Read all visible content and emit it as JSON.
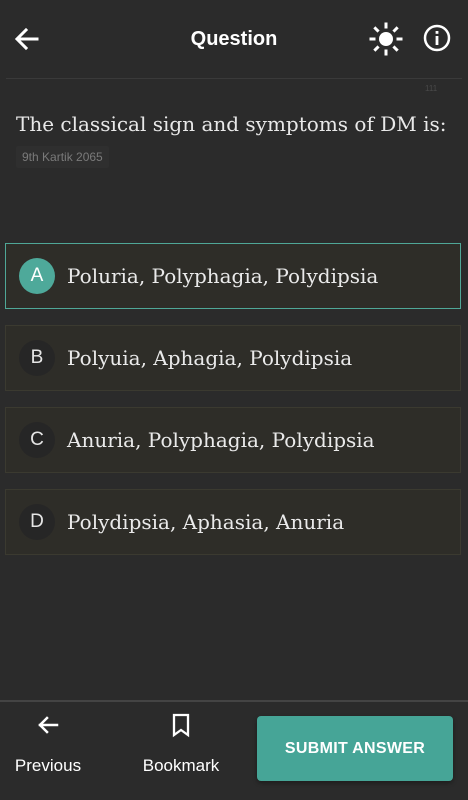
{
  "header": {
    "title": "Question",
    "back_icon": "arrow-left-icon",
    "theme_icon": "sun-icon",
    "info_icon": "info-icon"
  },
  "question": {
    "text": "The classical sign and symptoms of DM is:",
    "tag": "9th Kartik 2065"
  },
  "options": [
    {
      "letter": "A",
      "text": "Poluria, Polyphagia, Polydipsia",
      "selected": true
    },
    {
      "letter": "B",
      "text": "Polyuia, Aphagia, Polydipsia",
      "selected": false
    },
    {
      "letter": "C",
      "text": "Anuria, Polyphagia, Polydipsia",
      "selected": false
    },
    {
      "letter": "D",
      "text": "Polydipsia, Aphasia, Anuria",
      "selected": false
    }
  ],
  "bottom_bar": {
    "previous_label": "Previous",
    "bookmark_label": "Bookmark",
    "submit_label": "SUBMIT ANSWER"
  },
  "colors": {
    "accent": "#46a597",
    "background": "#2b2b2b",
    "option_bg": "#2e2d28"
  }
}
